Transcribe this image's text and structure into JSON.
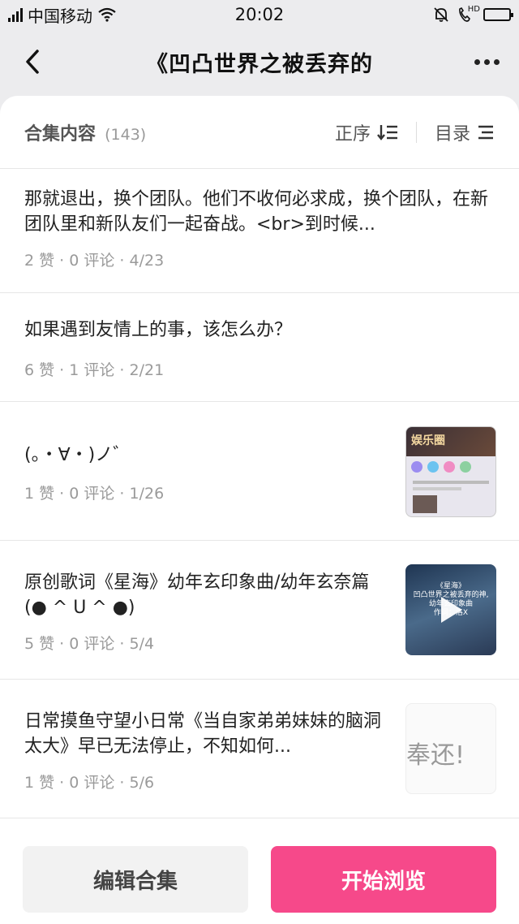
{
  "status_bar": {
    "carrier": "中国移动",
    "time": "20:02",
    "network_badge": "HD",
    "battery_level": 1.0
  },
  "nav": {
    "title": "《凹凸世界之被丢弃的",
    "back_icon": "back-arrow-icon",
    "more_icon": "more-dots-icon"
  },
  "collection": {
    "title": "合集内容",
    "count": "(143)",
    "sort_label": "正序",
    "toc_label": "目录"
  },
  "items": [
    {
      "text": "那就退出，换个团队。他们不收何必求成，换个团队，在新团队里和新队友们一起奋战。<br>到时候...",
      "meta": "2 赞 · 0 评论 · 4/23",
      "has_thumb": false
    },
    {
      "text": "如果遇到友情上的事，该怎么办？",
      "meta": "6 赞 · 1 评论 · 2/21",
      "has_thumb": false
    },
    {
      "text": "(。・∀・)ノ゛",
      "meta": "1 赞 · 0 评论 · 1/26",
      "has_thumb": true,
      "thumb_text": "娱乐圈"
    },
    {
      "text": "原创歌词《星海》幼年玄印象曲/幼年玄奈篇(● ^ U ^ ●)",
      "meta": "5 赞 · 0 评论 · 5/4",
      "has_thumb": true,
      "thumb_lines": [
        "《星海》",
        "凹凸世界之被丢弃的神,",
        "幼年玄印象曲",
        "作词：洛X"
      ]
    },
    {
      "text": "日常摸鱼守望小日常《当自家弟弟妹妹的脑洞太大》早已无法停止，不知如何...",
      "meta": "1 赞 · 0 评论 · 5/6",
      "has_thumb": true,
      "thumb_text": "奉还!"
    }
  ],
  "actions": {
    "edit_label": "编辑合集",
    "browse_label": "开始浏览"
  },
  "colors": {
    "accent": "#f6498a",
    "meta_gray": "#9a9a9a"
  }
}
